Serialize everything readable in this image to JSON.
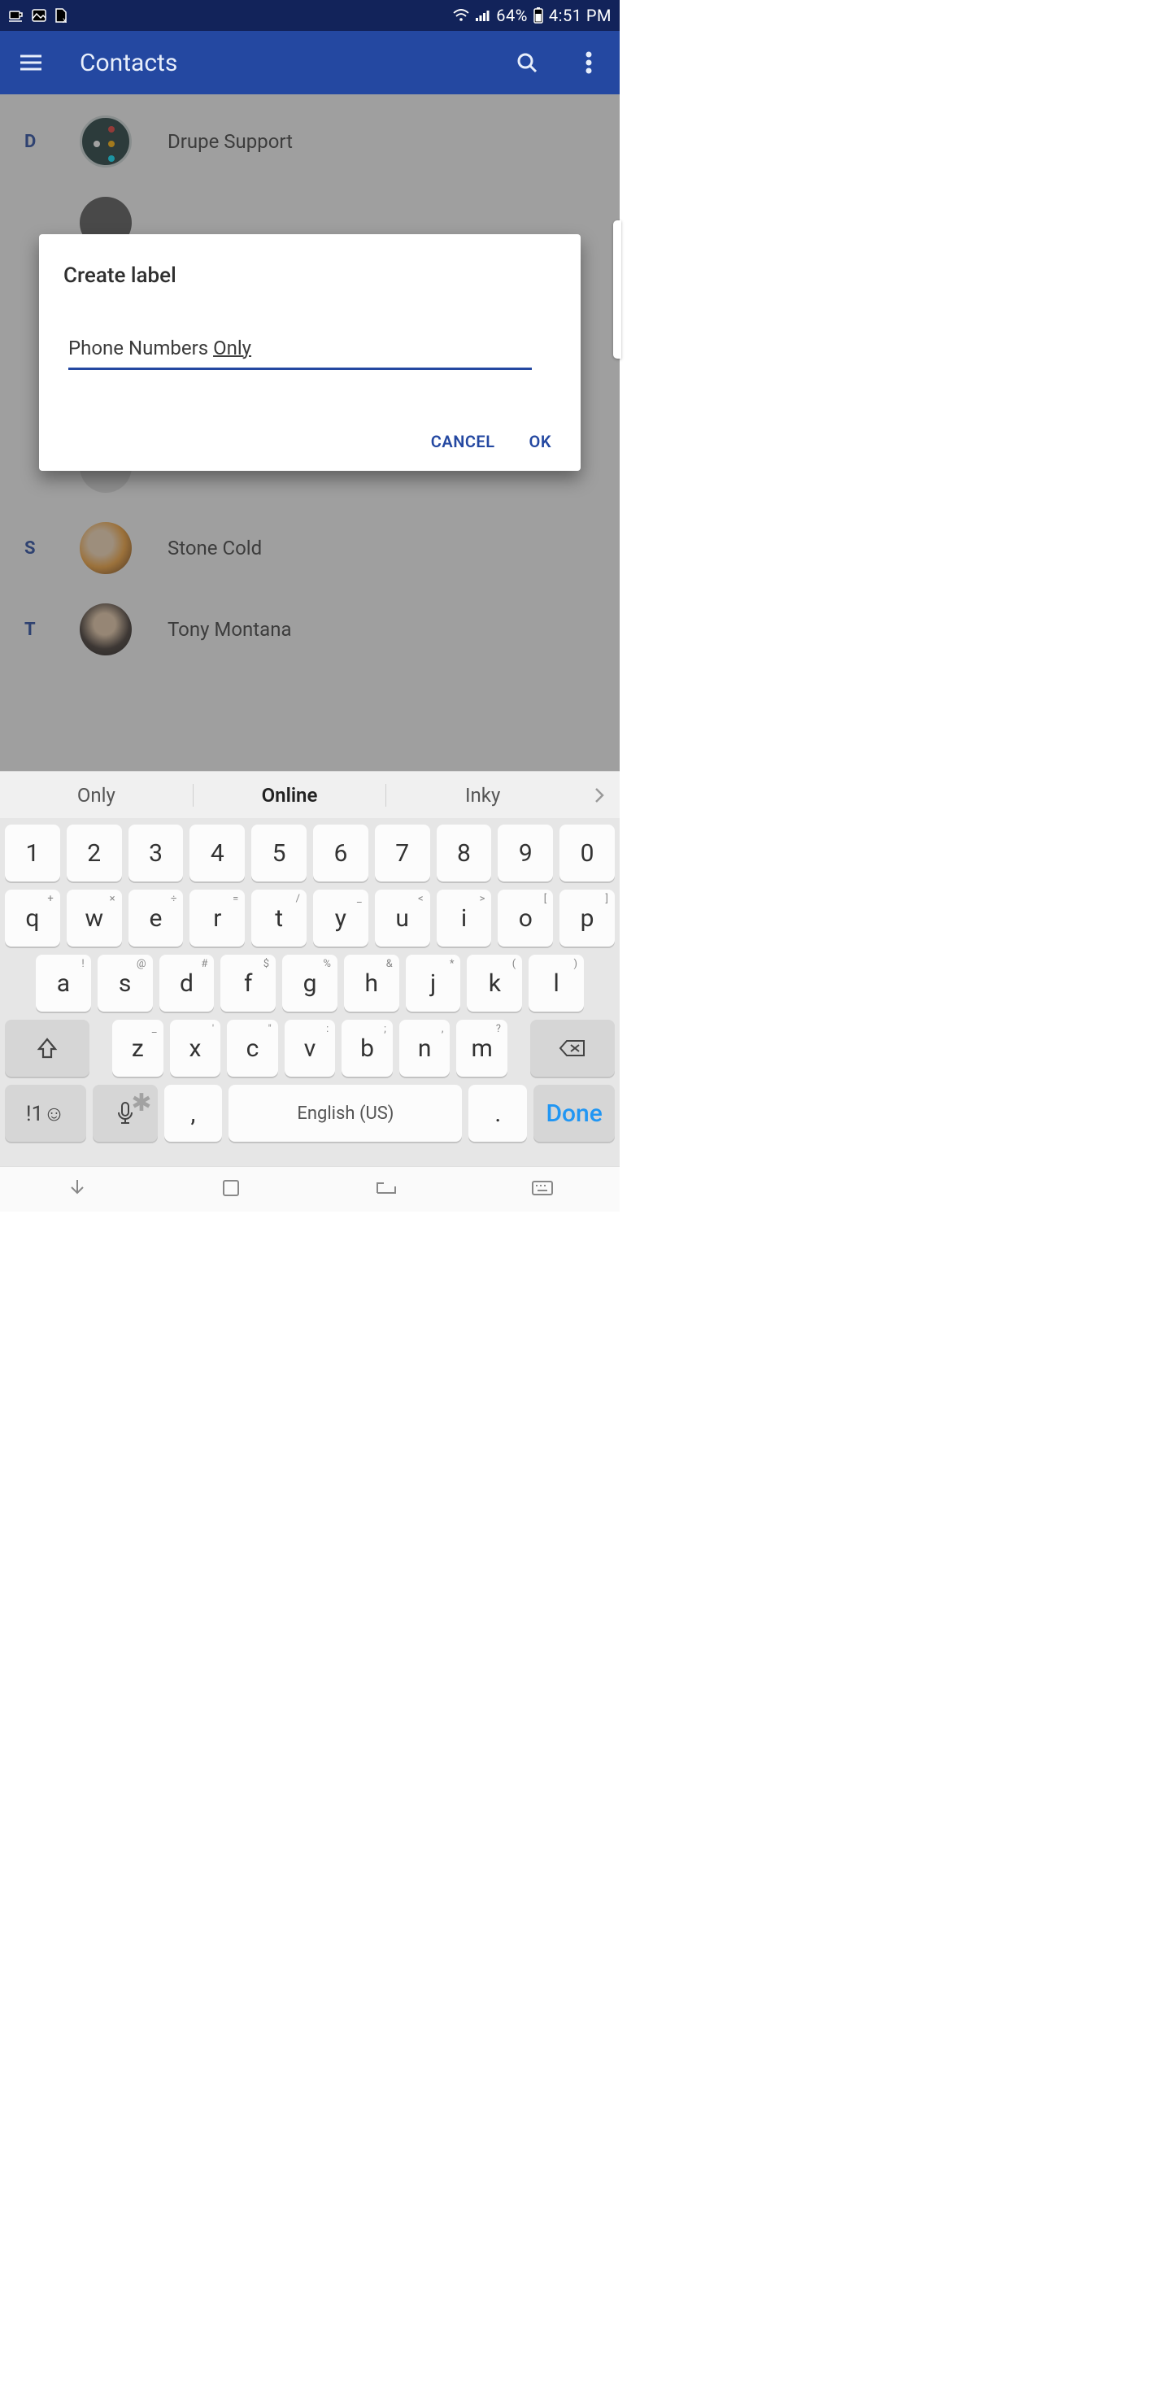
{
  "statusbar": {
    "battery_pct": "64%",
    "time": "4:51 PM"
  },
  "appbar": {
    "title": "Contacts"
  },
  "contacts": [
    {
      "index": "D",
      "name": "Drupe Support",
      "avatar_kind": "drupe"
    },
    {
      "index": "",
      "name": "",
      "avatar_kind": "hidden1"
    },
    {
      "index": "",
      "name": "",
      "avatar_kind": "hidden2"
    },
    {
      "index": "",
      "name": "",
      "avatar_kind": "hidden3"
    },
    {
      "index": "",
      "name": "",
      "avatar_kind": "hidden4"
    },
    {
      "index": "S",
      "name": "Stone Cold",
      "avatar_kind": "stone"
    },
    {
      "index": "T",
      "name": "Tony Montana",
      "avatar_kind": "tony"
    }
  ],
  "dialog": {
    "title": "Create label",
    "input_prefix": "Phone Numbers ",
    "input_last_word": "Only",
    "cancel_label": "CANCEL",
    "ok_label": "OK"
  },
  "suggestions": {
    "a": "Only",
    "b": "Online",
    "c": "Inky"
  },
  "keyboard": {
    "row_num": [
      "1",
      "2",
      "3",
      "4",
      "5",
      "6",
      "7",
      "8",
      "9",
      "0"
    ],
    "row_q": [
      [
        "q",
        "+"
      ],
      [
        "w",
        "×"
      ],
      [
        "e",
        "÷"
      ],
      [
        "r",
        "="
      ],
      [
        "t",
        "/"
      ],
      [
        "y",
        "_"
      ],
      [
        "u",
        "<"
      ],
      [
        "i",
        ">"
      ],
      [
        "o",
        "["
      ],
      [
        "p",
        "]"
      ]
    ],
    "row_a": [
      [
        "a",
        "!"
      ],
      [
        "s",
        "@"
      ],
      [
        "d",
        "#"
      ],
      [
        "f",
        "$"
      ],
      [
        "g",
        "%"
      ],
      [
        "h",
        "&"
      ],
      [
        "j",
        "*"
      ],
      [
        "k",
        "("
      ],
      [
        "l",
        ")"
      ]
    ],
    "row_z": [
      [
        "z",
        "_"
      ],
      [
        "x",
        "'"
      ],
      [
        "c",
        "\""
      ],
      [
        "v",
        ":"
      ],
      [
        "b",
        ";"
      ],
      [
        "n",
        ","
      ],
      [
        "m",
        "?"
      ]
    ],
    "symnum": "!1☺",
    "comma": ",",
    "space": "English (US)",
    "period": ".",
    "done": "Done"
  }
}
